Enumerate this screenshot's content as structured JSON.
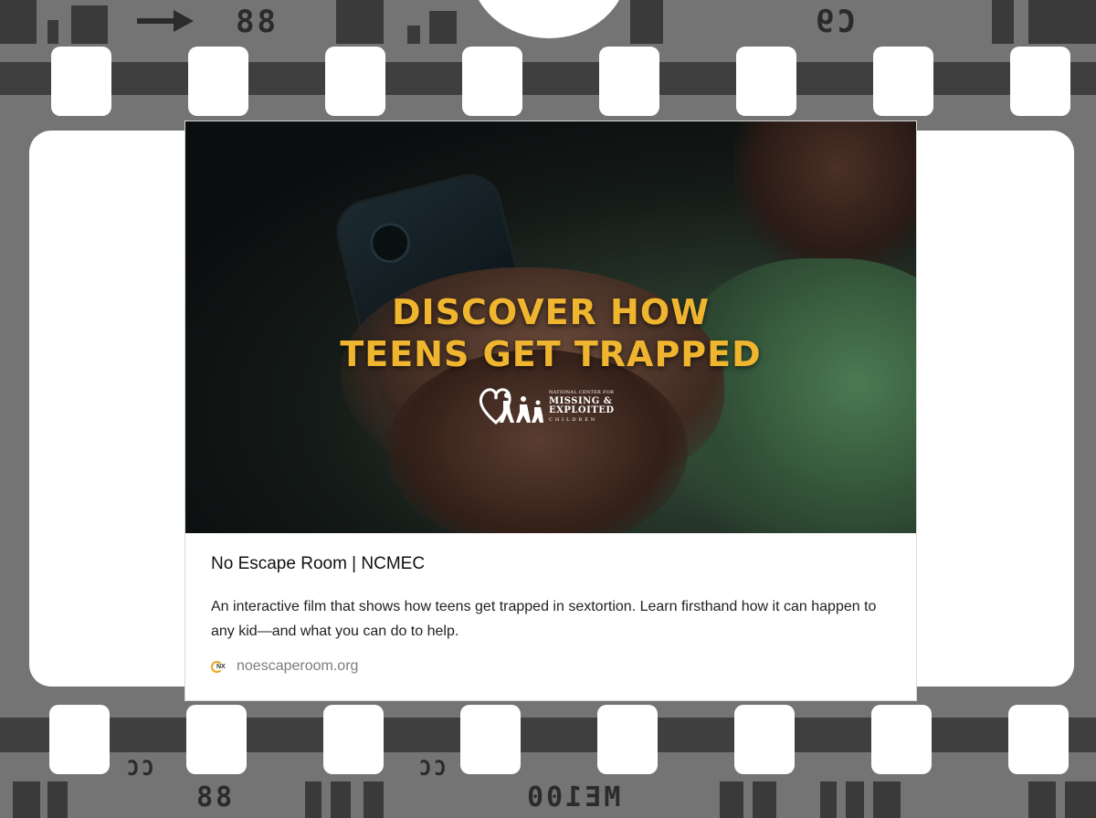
{
  "film_strip": {
    "top_edge_text": [
      "88",
      "C9"
    ],
    "bottom_edge_text": [
      "CC",
      "88",
      "CC",
      "ME100"
    ]
  },
  "link_preview": {
    "image": {
      "headline_line1": "DISCOVER HOW",
      "headline_line2": "TEENS GET TRAPPED",
      "logo_text": [
        "NATIONAL CENTER FOR",
        "MISSING &",
        "EXPLOITED",
        "CHILDREN"
      ]
    },
    "title": "No Escape Room | NCMEC",
    "description": "An interactive film that shows how teens get trapped in sextortion. Learn firsthand how it can happen to any kid—and what you can do to help.",
    "domain": "noescaperoom.org",
    "favicon_text": "NX"
  },
  "colors": {
    "headline": "#f0b52e",
    "film_border": "#747474",
    "film_band": "#3f3f3f"
  },
  "icons": [
    "arrow-right-icon",
    "site-favicon-icon",
    "ncmec-logo-icon"
  ]
}
